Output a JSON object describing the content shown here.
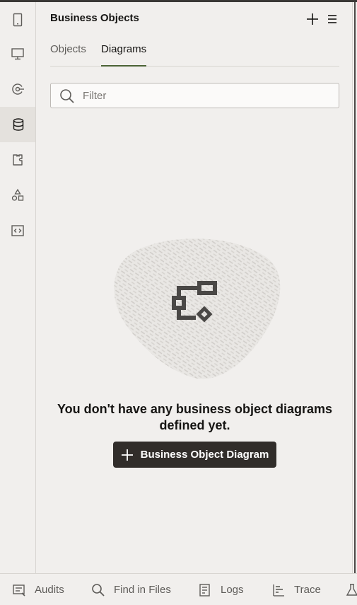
{
  "panel": {
    "title": "Business Objects",
    "add_icon": "plus-icon",
    "menu_icon": "hamburger-icon"
  },
  "tabs": [
    {
      "label": "Objects",
      "selected": false
    },
    {
      "label": "Diagrams",
      "selected": true
    }
  ],
  "filter": {
    "placeholder": "Filter",
    "value": ""
  },
  "rail": [
    {
      "icon": "mobile-icon",
      "active": false
    },
    {
      "icon": "desktop-icon",
      "active": false
    },
    {
      "icon": "service-connection-icon",
      "active": false
    },
    {
      "icon": "database-icon",
      "active": true
    },
    {
      "icon": "component-icon",
      "active": false
    },
    {
      "icon": "shapes-icon",
      "active": false
    },
    {
      "icon": "code-icon",
      "active": false
    }
  ],
  "empty_state": {
    "message": "You don't have any business object diagrams defined yet.",
    "button_label": "Business Object Diagram"
  },
  "bottom_tabs": [
    {
      "label": "Audits",
      "icon": "audits-icon"
    },
    {
      "label": "Find in Files",
      "icon": "search-icon"
    },
    {
      "label": "Logs",
      "icon": "logs-icon"
    },
    {
      "label": "Trace",
      "icon": "trace-icon"
    }
  ],
  "colors": {
    "background": "#f1efed",
    "tab_underline": "#4b6336",
    "button_bg": "#312d2a",
    "text": "#161513"
  }
}
